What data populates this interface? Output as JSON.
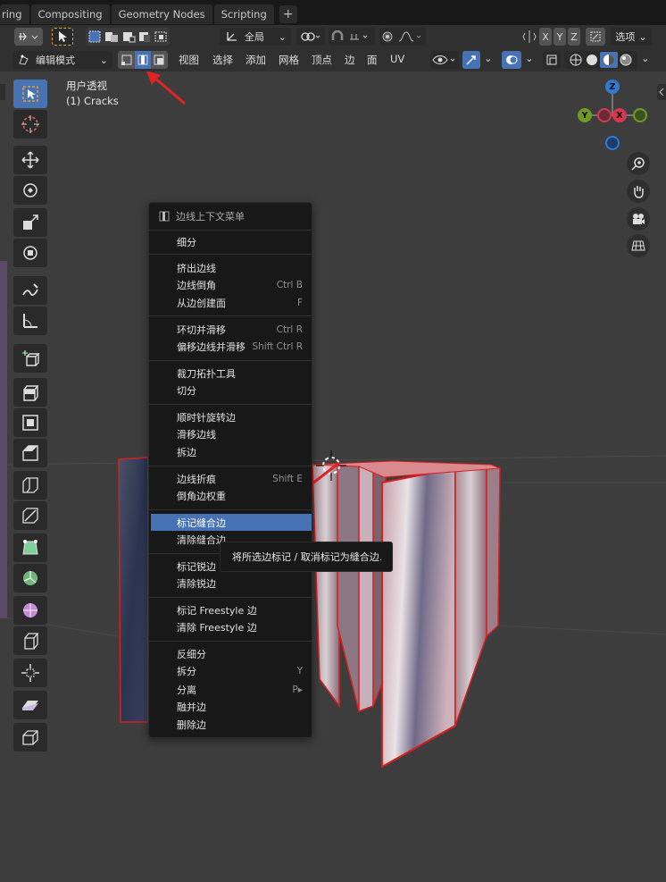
{
  "workspace_tabs": [
    "ring",
    "Compositing",
    "Geometry Nodes",
    "Scripting"
  ],
  "header1": {
    "transform_orientation": "全局",
    "axis_labels": [
      "X",
      "Y",
      "Z"
    ],
    "options_label": "选项"
  },
  "header2": {
    "mode_label": "编辑模式",
    "menus": [
      "视图",
      "选择",
      "添加",
      "网格",
      "顶点",
      "边",
      "面",
      "UV"
    ]
  },
  "viewport": {
    "view_name": "用户透视",
    "object_name": "(1) Cracks",
    "gizmo": {
      "z": "Z",
      "y": "Y",
      "x": "X"
    }
  },
  "context_menu": {
    "title": "边线上下文菜单",
    "groups": [
      [
        {
          "label": "细分",
          "shortcut": ""
        }
      ],
      [
        {
          "label": "挤出边线",
          "shortcut": ""
        },
        {
          "label": "边线倒角",
          "shortcut": "Ctrl B"
        },
        {
          "label": "从边创建面",
          "shortcut": "F"
        }
      ],
      [
        {
          "label": "环切并滑移",
          "shortcut": "Ctrl R"
        },
        {
          "label": "偏移边线并滑移",
          "shortcut": "Shift Ctrl R"
        }
      ],
      [
        {
          "label": "裁刀拓扑工具",
          "shortcut": ""
        },
        {
          "label": "切分",
          "shortcut": ""
        }
      ],
      [
        {
          "label": "顺时针旋转边",
          "shortcut": ""
        },
        {
          "label": "滑移边线",
          "shortcut": ""
        },
        {
          "label": "拆边",
          "shortcut": ""
        }
      ],
      [
        {
          "label": "边线折痕",
          "shortcut": "Shift E"
        },
        {
          "label": "倒角边权重",
          "shortcut": ""
        }
      ],
      [
        {
          "label": "标记缝合边",
          "shortcut": ""
        },
        {
          "label": "清除缝合边",
          "shortcut": ""
        }
      ],
      [
        {
          "label": "标记锐边",
          "shortcut": ""
        },
        {
          "label": "清除锐边",
          "shortcut": ""
        }
      ],
      [
        {
          "label": "标记 Freestyle 边",
          "shortcut": ""
        },
        {
          "label": "清除 Freestyle 边",
          "shortcut": ""
        }
      ],
      [
        {
          "label": "反细分",
          "shortcut": ""
        },
        {
          "label": "拆分",
          "shortcut": "Y"
        },
        {
          "label": "分离",
          "shortcut": "P▸"
        },
        {
          "label": "融并边",
          "shortcut": ""
        },
        {
          "label": "删除边",
          "shortcut": ""
        }
      ]
    ],
    "highlighted": "标记缝合边"
  },
  "tooltip": "将所选边标记 / 取消标记为缝合边.",
  "colors": {
    "accent": "#4772b3",
    "annotation_arrow": "#e02424",
    "selected_edge": "#d81f1f",
    "gizmo_x": "#d6384f",
    "gizmo_y": "#6e9a26",
    "gizmo_z": "#2f7bd2"
  }
}
